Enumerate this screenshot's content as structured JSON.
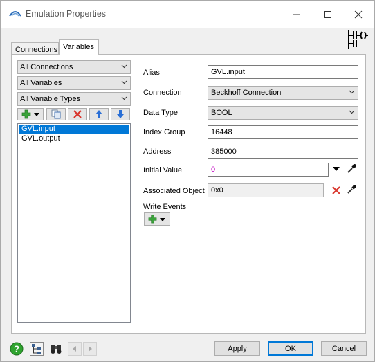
{
  "window": {
    "title": "Emulation Properties"
  },
  "tabs": [
    {
      "label": "Connections",
      "selected": false
    },
    {
      "label": "Variables",
      "selected": true
    }
  ],
  "filters": {
    "connections": "All Connections",
    "variables": "All Variables",
    "variable_types": "All Variable Types"
  },
  "variables": [
    {
      "label": "GVL.input",
      "selected": true
    },
    {
      "label": "GVL.output",
      "selected": false
    }
  ],
  "form": {
    "alias_label": "Alias",
    "alias_value": "GVL.input",
    "connection_label": "Connection",
    "connection_value": "Beckhoff Connection",
    "data_type_label": "Data Type",
    "data_type_value": "BOOL",
    "index_group_label": "Index Group",
    "index_group_value": "16448",
    "address_label": "Address",
    "address_value": "385000",
    "initial_value_label": "Initial Value",
    "initial_value_value": "0",
    "associated_object_label": "Associated Object",
    "associated_object_value": "0x0",
    "write_events_label": "Write Events"
  },
  "buttons": {
    "apply": "Apply",
    "ok": "OK",
    "cancel": "Cancel"
  },
  "colors": {
    "selection": "#0078d7",
    "initial_value_text": "#c000c0",
    "add_green": "#3aa33a",
    "delete_red": "#d9342b",
    "arrow_blue": "#2a6fd6"
  }
}
